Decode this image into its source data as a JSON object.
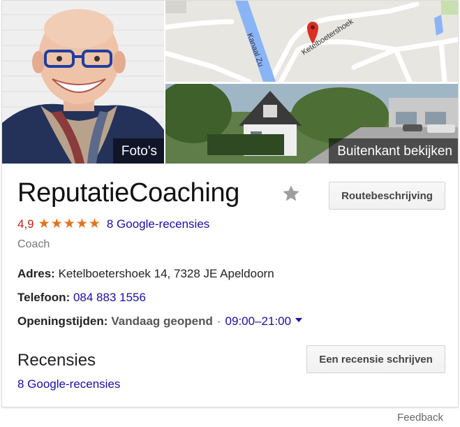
{
  "media": {
    "photos_label": "Foto's",
    "street_label": "Buitenkant bekijken",
    "map_street_name": "Ketelboetershoek",
    "map_canal_name": "Kanaal Zu"
  },
  "business": {
    "name": "ReputatieCoaching",
    "route_label": "Routebeschrijving",
    "rating_value": "4,9",
    "stars": 5,
    "star_glyph": "★",
    "reviews_link": "8 Google-recensies",
    "category": "Coach"
  },
  "info": {
    "address_label": "Adres:",
    "address_value": "Ketelboetershoek 14, 7328 JE Apeldoorn",
    "phone_label": "Telefoon:",
    "phone_value": "084 883 1556",
    "hours_label": "Openingstijden:",
    "hours_status": "Vandaag geopend",
    "hours_separator": "·",
    "hours_value": "09:00–21:00"
  },
  "reviews": {
    "heading": "Recensies",
    "write_label": "Een recensie schrijven",
    "link": "8 Google-recensies"
  },
  "footer": {
    "feedback": "Feedback"
  },
  "colors": {
    "rating_red": "#c5221f",
    "star_orange": "#e7711b",
    "link_blue": "#1a0dab",
    "map_pin_red": "#d93025"
  }
}
